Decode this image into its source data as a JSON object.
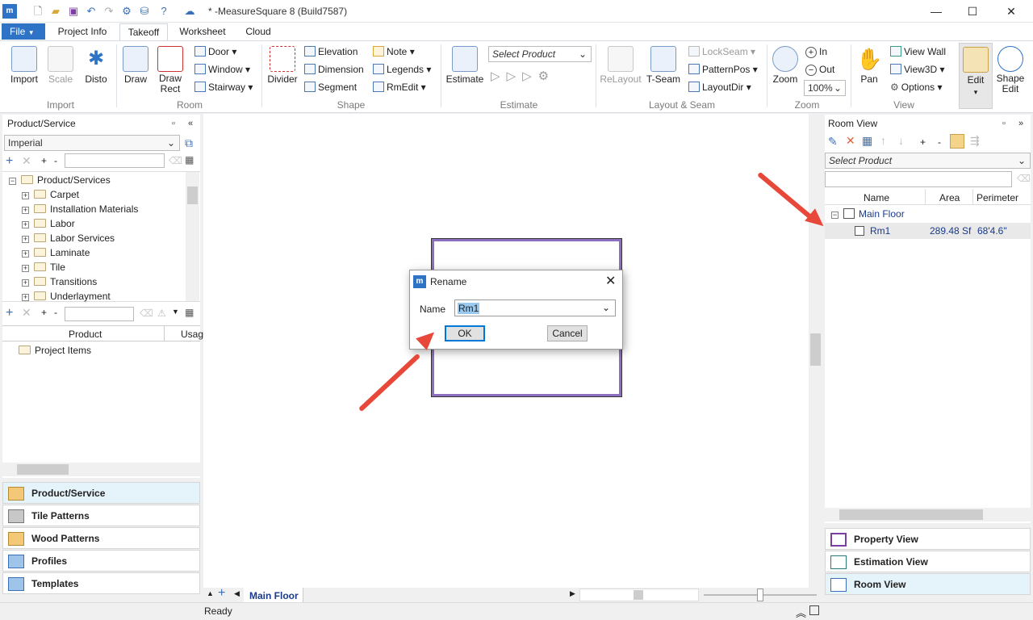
{
  "window": {
    "title": "* -MeasureSquare 8 (Build7587)",
    "minimize": "—",
    "maximize": "☐",
    "close": "✕"
  },
  "tabs": {
    "file": "File",
    "file_arrow": "▼",
    "items": [
      "Project Info",
      "Takeoff",
      "Worksheet",
      "Cloud"
    ],
    "active": "Takeoff"
  },
  "ribbon": {
    "import": "Import",
    "scale": "Scale",
    "disto": "Disto",
    "draw": "Draw",
    "draw_rect": "Draw Rect",
    "door": "Door",
    "window": "Window",
    "stairway": "Stairway",
    "divider": "Divider",
    "elevation": "Elevation",
    "dimension": "Dimension",
    "segment": "Segment",
    "note": "Note",
    "legends": "Legends",
    "rmedit": "RmEdit",
    "estimate": "Estimate",
    "select_product": "Select Product",
    "relayout": "ReLayout",
    "tseam": "T-Seam",
    "lockseam": "LockSeam",
    "patternpos": "PatternPos",
    "layoutdir": "LayoutDir",
    "zoom": "Zoom",
    "zoom_in": "In",
    "zoom_out": "Out",
    "zoom_level": "100%",
    "pan": "Pan",
    "view_wall": "View Wall",
    "view3d": "View3D",
    "options": "Options",
    "edit": "Edit",
    "shape_edit": "Shape Edit",
    "groups": [
      "Import",
      "Room",
      "Shape",
      "Estimate",
      "Layout & Seam",
      "Zoom",
      "View"
    ]
  },
  "left_panel": {
    "title": "Product/Service",
    "unit": "Imperial",
    "tree_root": "Product/Services",
    "tree_items": [
      "Carpet",
      "Installation Materials",
      "Labor",
      "Labor Services",
      "Laminate",
      "Tile",
      "Transitions",
      "Underlayment"
    ],
    "col_product": "Product",
    "col_usage": "Usag",
    "project_items": "Project Items",
    "nav": [
      "Product/Service",
      "Tile Patterns",
      "Wood Patterns",
      "Profiles",
      "Templates"
    ]
  },
  "dialog": {
    "title": "Rename",
    "name_label": "Name",
    "name_value": "Rm1",
    "ok": "OK",
    "cancel": "Cancel"
  },
  "right_panel": {
    "title": "Room View",
    "select_product": "Select Product",
    "columns": [
      "Name",
      "Area",
      "Perimeter"
    ],
    "floor": "Main Floor",
    "rooms": [
      {
        "name": "Rm1",
        "area": "289.48 Sf",
        "perimeter": "68'4.6\""
      }
    ],
    "nav": [
      "Property View",
      "Estimation View",
      "Room View"
    ]
  },
  "canvas": {
    "floor_tab": "Main Floor"
  },
  "status": {
    "text": "Ready"
  },
  "colors": {
    "accent": "#2f73c7",
    "room_border": "#8e6fbf",
    "arrow": "#e8483a"
  }
}
